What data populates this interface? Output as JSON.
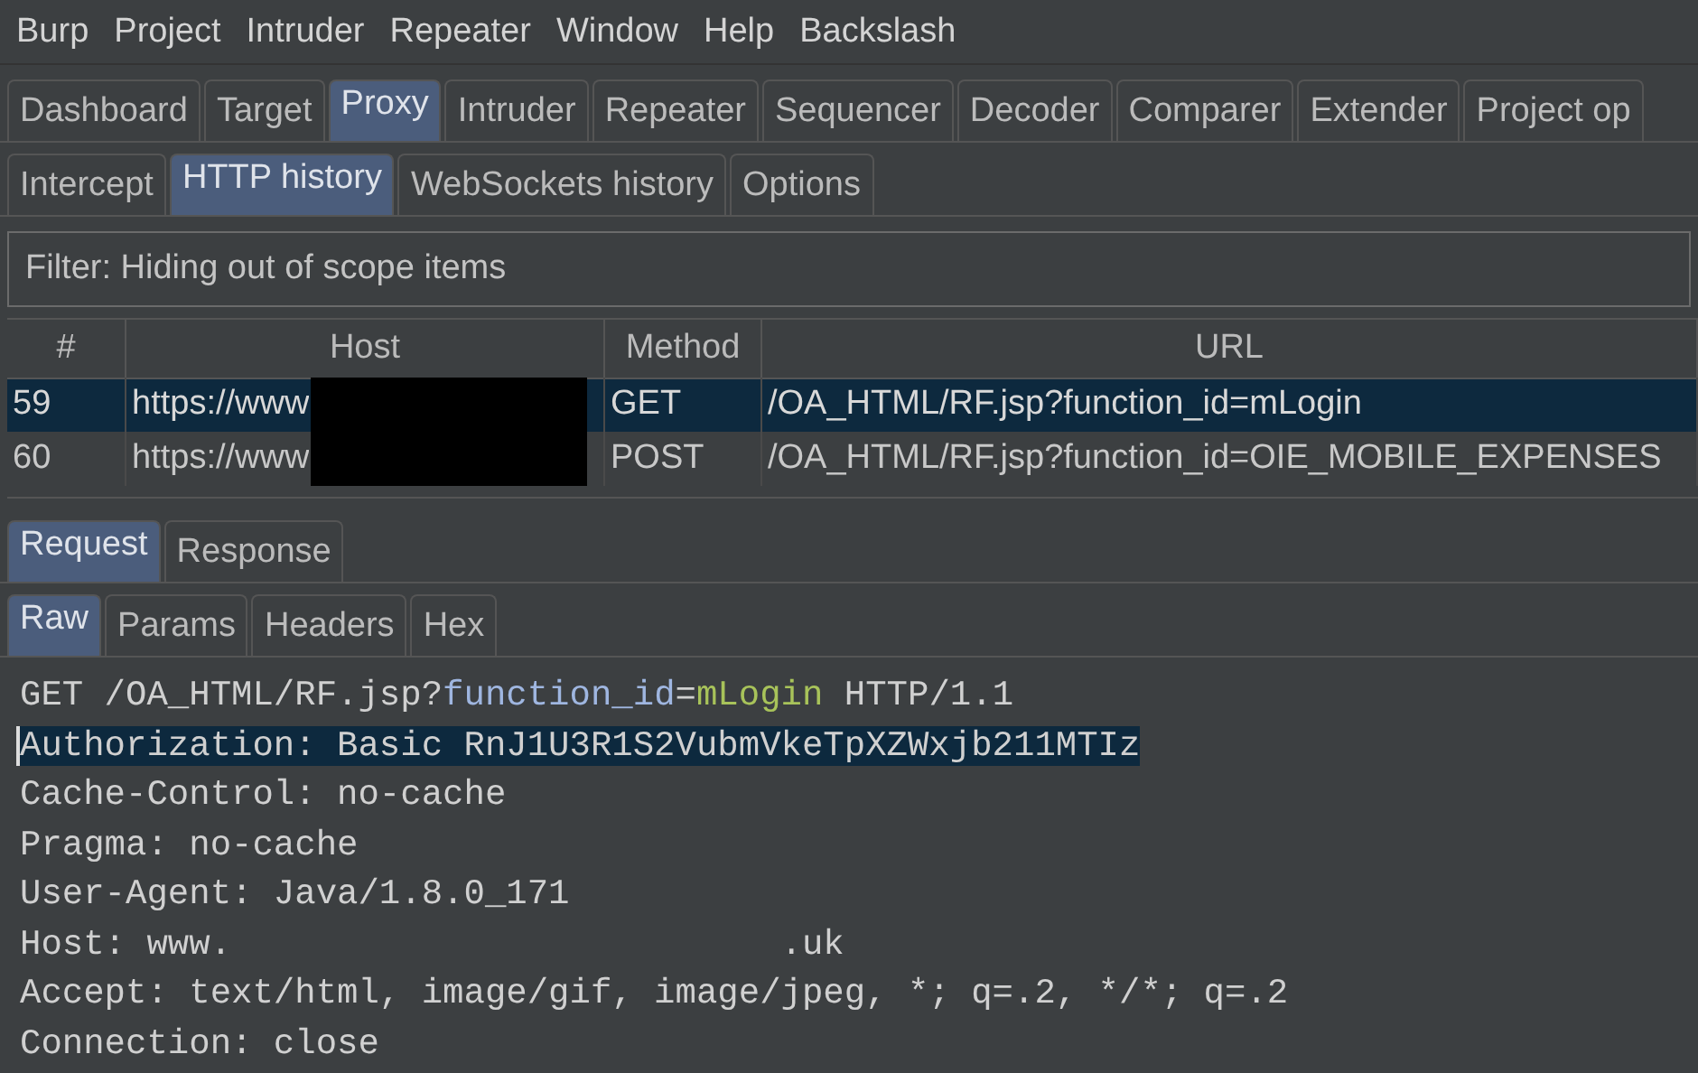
{
  "menu": [
    "Burp",
    "Project",
    "Intruder",
    "Repeater",
    "Window",
    "Help",
    "Backslash"
  ],
  "main_tabs": [
    {
      "label": "Dashboard",
      "selected": false
    },
    {
      "label": "Target",
      "selected": false
    },
    {
      "label": "Proxy",
      "selected": true
    },
    {
      "label": "Intruder",
      "selected": false
    },
    {
      "label": "Repeater",
      "selected": false
    },
    {
      "label": "Sequencer",
      "selected": false
    },
    {
      "label": "Decoder",
      "selected": false
    },
    {
      "label": "Comparer",
      "selected": false
    },
    {
      "label": "Extender",
      "selected": false
    },
    {
      "label": "Project op",
      "selected": false
    }
  ],
  "proxy_tabs": [
    {
      "label": "Intercept",
      "selected": false
    },
    {
      "label": "HTTP history",
      "selected": true
    },
    {
      "label": "WebSockets history",
      "selected": false
    },
    {
      "label": "Options",
      "selected": false
    }
  ],
  "filter": "Filter: Hiding out of scope items",
  "table": {
    "host_redacted": true,
    "columns": [
      "#",
      "Host",
      "Method",
      "URL"
    ],
    "rows": [
      {
        "cells": [
          "59",
          "https://www",
          "GET",
          "/OA_HTML/RF.jsp?function_id=mLogin"
        ],
        "selected": true
      },
      {
        "cells": [
          "60",
          "https://www",
          "POST",
          "/OA_HTML/RF.jsp?function_id=OIE_MOBILE_EXPENSES"
        ],
        "selected": false
      }
    ]
  },
  "message_tabs": [
    {
      "label": "Request",
      "selected": true
    },
    {
      "label": "Response",
      "selected": false
    }
  ],
  "view_tabs": [
    {
      "label": "Raw",
      "selected": true
    },
    {
      "label": "Params",
      "selected": false
    },
    {
      "label": "Headers",
      "selected": false
    },
    {
      "label": "Hex",
      "selected": false
    }
  ],
  "request_lines": [
    {
      "selected": false,
      "segments": [
        {
          "kind": "plain",
          "text": "GET /OA_HTML/RF.jsp?"
        },
        {
          "kind": "param-name",
          "text": "function_id"
        },
        {
          "kind": "plain",
          "text": "="
        },
        {
          "kind": "param-value",
          "text": "mLogin"
        },
        {
          "kind": "plain",
          "text": " HTTP/1.1"
        }
      ]
    },
    {
      "selected": true,
      "segments": [
        {
          "kind": "plain",
          "text": "Authorization: Basic RnJ1U3R1S2VubmVkeTpXZWxjb211MTIz"
        }
      ]
    },
    {
      "selected": false,
      "segments": [
        {
          "kind": "plain",
          "text": "Cache-Control: no-cache"
        }
      ]
    },
    {
      "selected": false,
      "segments": [
        {
          "kind": "plain",
          "text": "Pragma: no-cache"
        }
      ]
    },
    {
      "selected": false,
      "segments": [
        {
          "kind": "plain",
          "text": "User-Agent: Java/1.8.0_171"
        }
      ]
    },
    {
      "selected": false,
      "segments": [
        {
          "kind": "plain",
          "text": "Host: www."
        },
        {
          "kind": "blank"
        },
        {
          "kind": "plain",
          "text": ".uk"
        }
      ]
    },
    {
      "selected": false,
      "segments": [
        {
          "kind": "plain",
          "text": "Accept: text/html, image/gif, image/jpeg, *; q=.2, */*; q=.2"
        }
      ]
    },
    {
      "selected": false,
      "segments": [
        {
          "kind": "plain",
          "text": "Connection: close"
        }
      ]
    }
  ]
}
